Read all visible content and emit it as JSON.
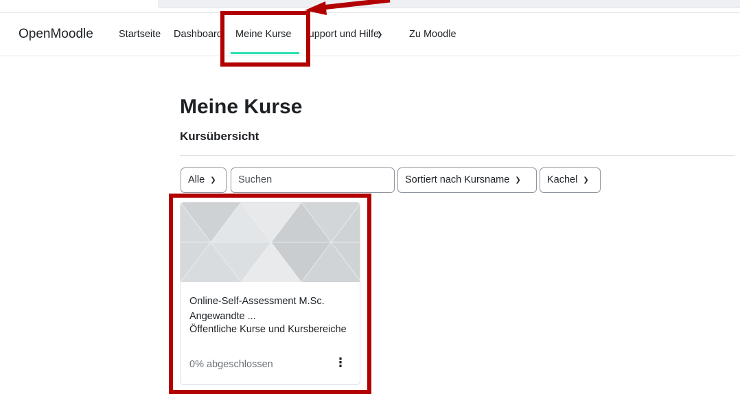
{
  "navbar": {
    "brand": "OpenMoodle",
    "items": [
      {
        "label": "Startseite"
      },
      {
        "label": "Dashboard"
      },
      {
        "label": "Meine Kurse"
      },
      {
        "label": "Support und Hilfe"
      },
      {
        "label": "Zu Moodle"
      }
    ],
    "active_index": 2
  },
  "main": {
    "title": "Meine Kurse",
    "section_title": "Kursübersicht",
    "filters": {
      "grouping": "Alle",
      "search_placeholder": "Suchen",
      "sort": "Sortiert nach Kursname",
      "view": "Kachel"
    },
    "courses": [
      {
        "title": "Online-Self-Assessment M.Sc. Angewandte ...",
        "category": "Öffentliche Kurse und Kursbereiche",
        "progress_text": "0% abgeschlossen",
        "progress": 0
      }
    ]
  },
  "colors": {
    "active_underline": "#27e0b0",
    "annotation": "#b20000",
    "card_pattern": "#dfe2e5"
  },
  "icons": {
    "dropdown": "chevron-down-icon",
    "course_menu": "kebab-menu-icon"
  }
}
